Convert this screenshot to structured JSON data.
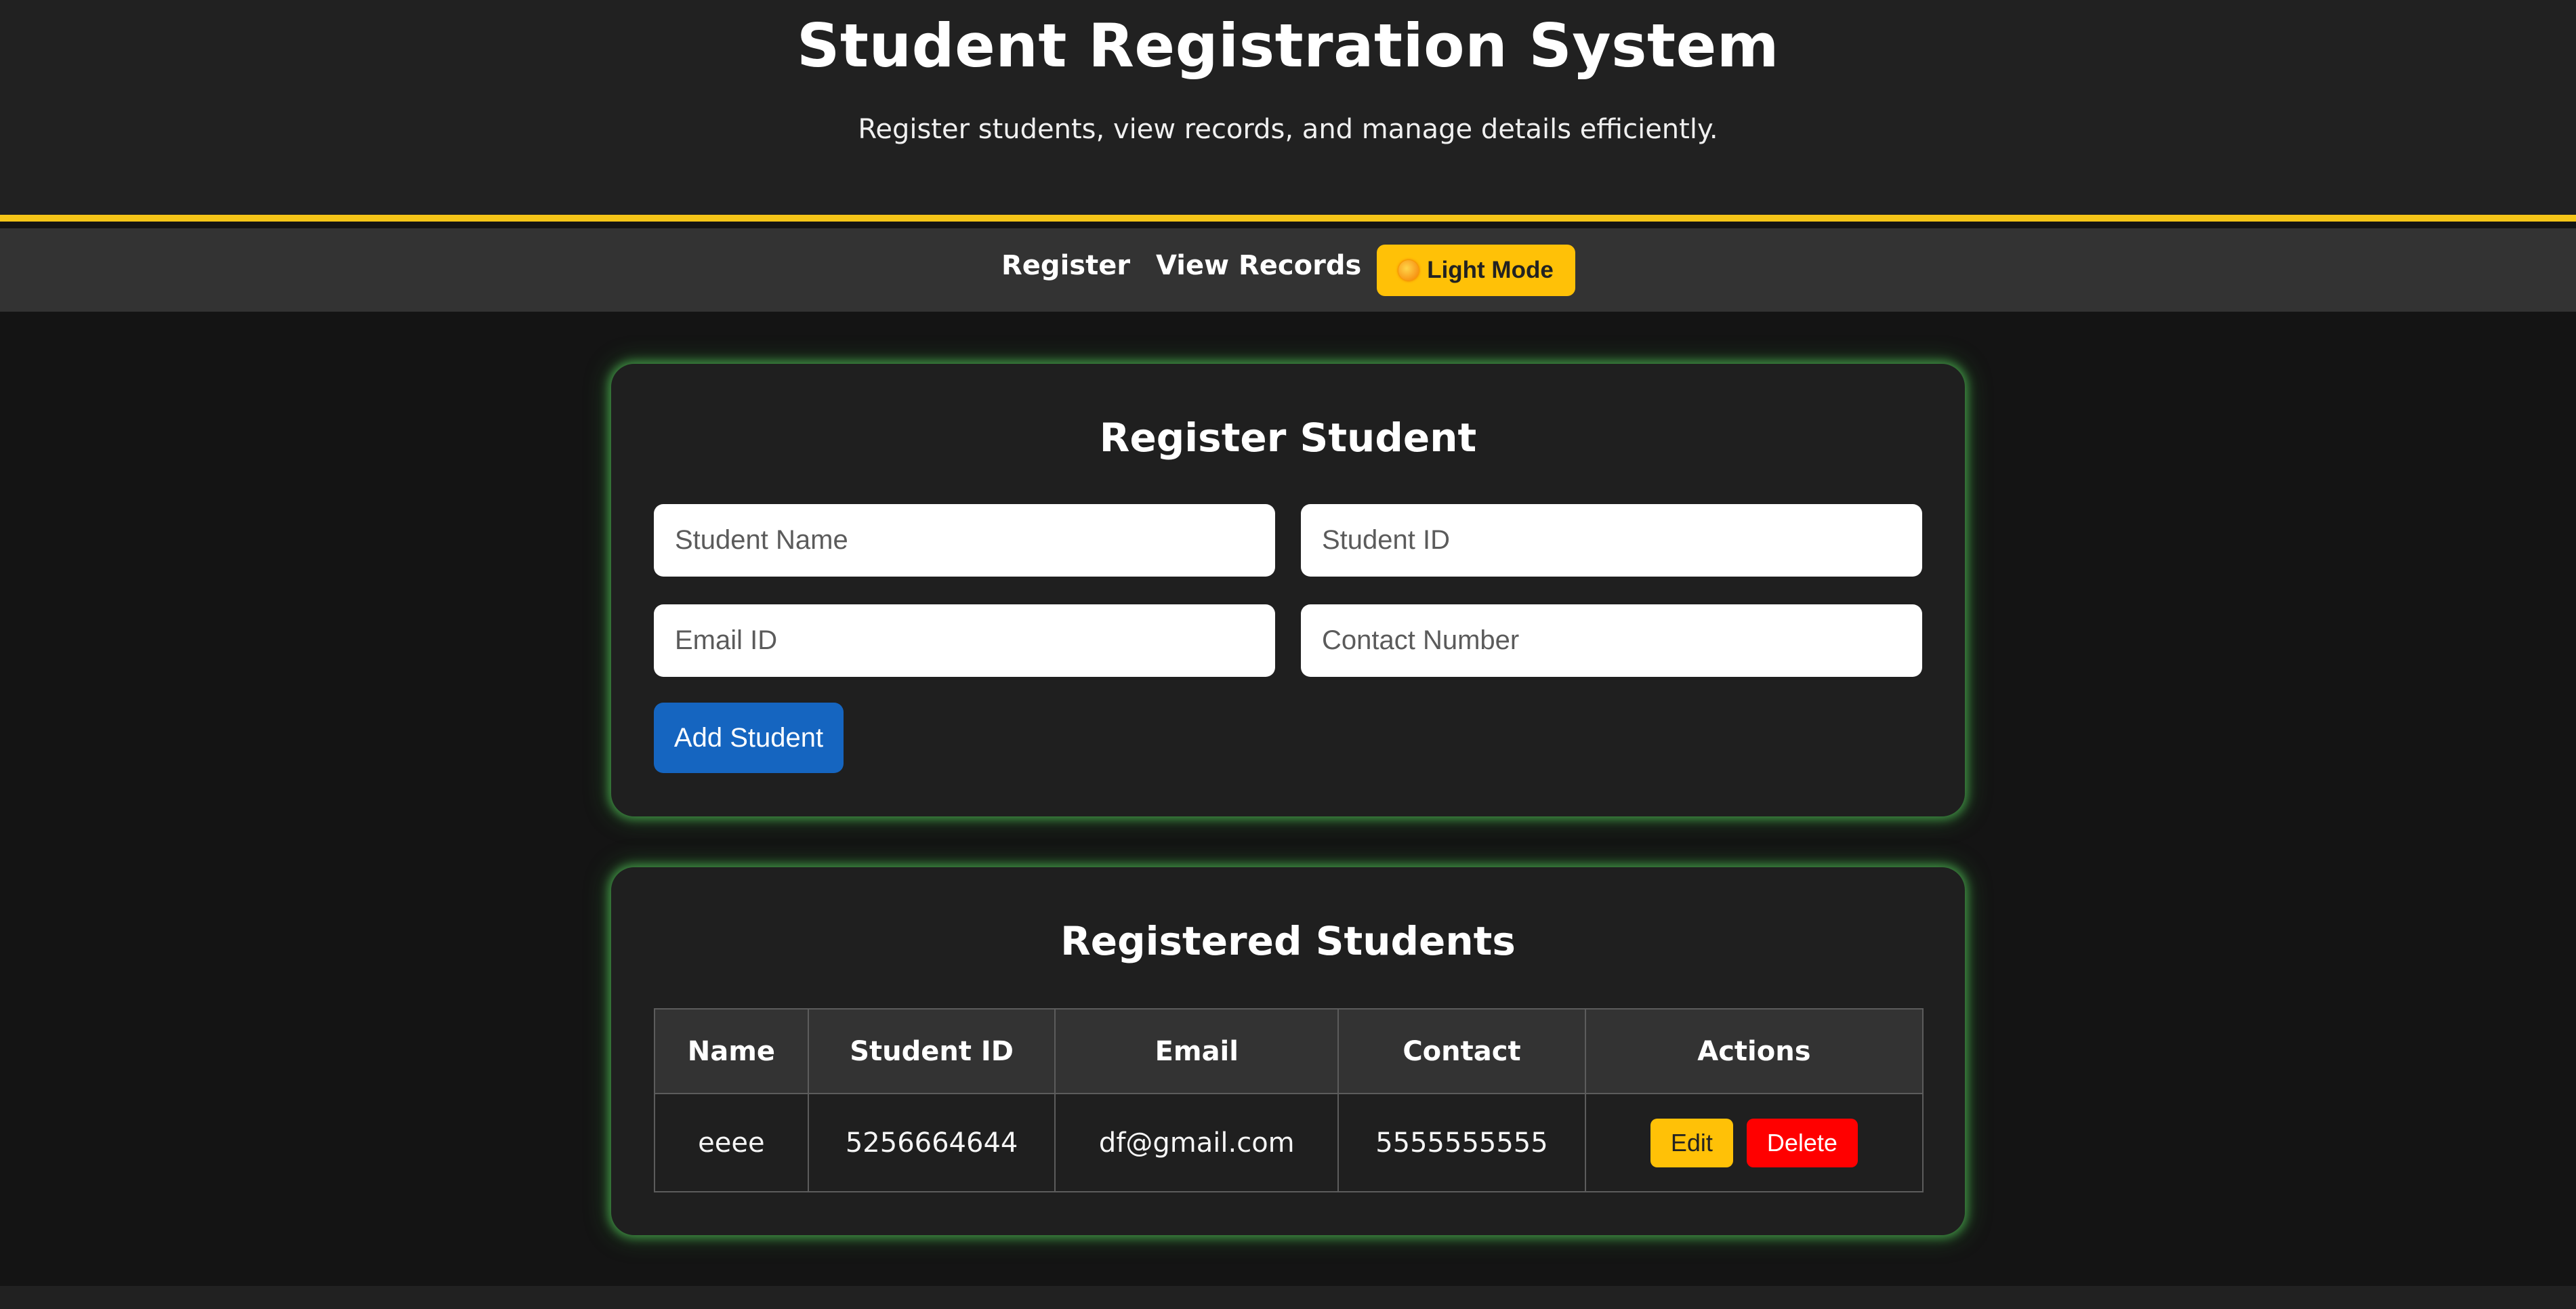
{
  "header": {
    "title": "Student Registration System",
    "subtitle": "Register students, view records, and manage details efficiently."
  },
  "nav": {
    "register_label": "Register",
    "records_label": "View Records",
    "theme_toggle_label": "Light Mode",
    "theme_toggle_icon": "sun-icon"
  },
  "register_form": {
    "heading": "Register Student",
    "name_placeholder": "Student Name",
    "id_placeholder": "Student ID",
    "email_placeholder": "Email ID",
    "contact_placeholder": "Contact Number",
    "submit_label": "Add Student"
  },
  "records": {
    "heading": "Registered Students",
    "columns": [
      "Name",
      "Student ID",
      "Email",
      "Contact",
      "Actions"
    ],
    "rows": [
      {
        "name": "eeee",
        "student_id": "5256664644",
        "email": "df@gmail.com",
        "contact": "5555555555",
        "edit_label": "Edit",
        "delete_label": "Delete"
      }
    ]
  },
  "colors": {
    "accent_yellow": "#ffc107",
    "primary_blue": "#1565c0",
    "danger_red": "#ff0000",
    "glow_green": "#4caf50",
    "header_bg": "#212121",
    "nav_bg": "#333333",
    "page_bg": "#141414"
  }
}
